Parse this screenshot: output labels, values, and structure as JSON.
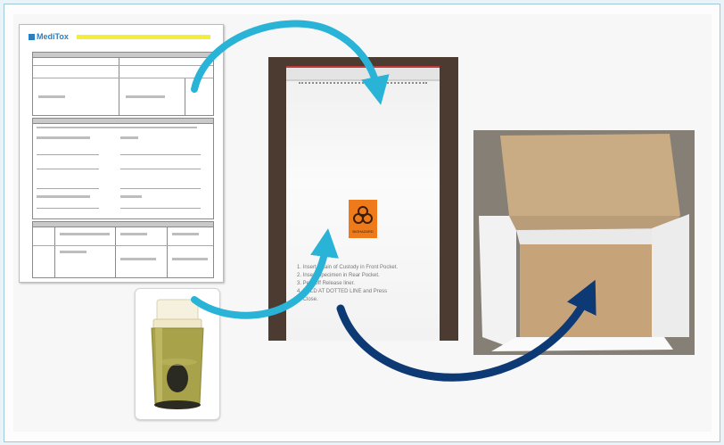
{
  "form": {
    "logo_text": "MediTox",
    "icon": "document-form"
  },
  "bag": {
    "instructions": [
      "1. Insert Chain of Custody in Front Pocket.",
      "2. Insert Specimen in Rear Pocket.",
      "3. Peel off Release liner.",
      "4. FOLD AT DOTTED LINE and Press",
      "to Close."
    ],
    "symbol_label": "BIOHAZARD"
  },
  "container": {
    "icon": "specimen-cup"
  },
  "box": {
    "icon": "open-cardboard-box"
  },
  "colors": {
    "arrow_light": "#29b3d6",
    "arrow_dark": "#0d3a75",
    "biohazard_orange": "#ee7a19",
    "frame_border": "#9fc8d8"
  }
}
